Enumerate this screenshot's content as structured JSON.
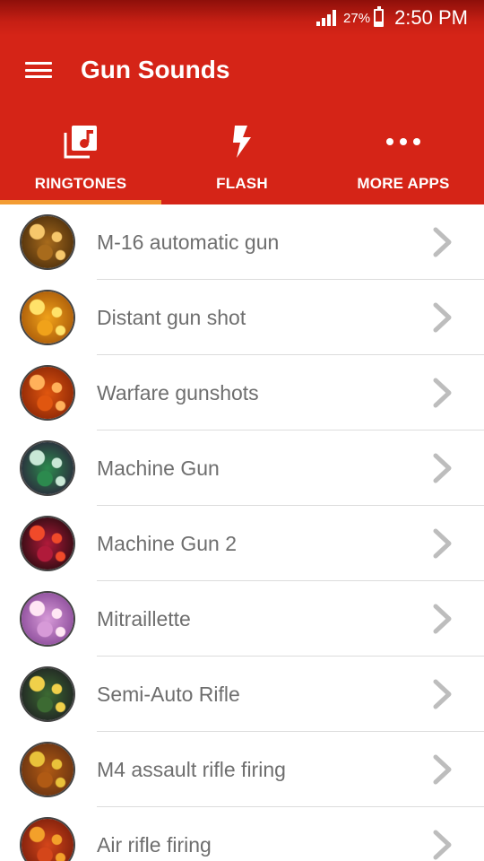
{
  "status_bar": {
    "battery_percent": "27%",
    "battery_level": 0.27,
    "time": "2:50 PM"
  },
  "app_bar": {
    "title": "Gun Sounds",
    "menu_icon": "hamburger-menu-icon"
  },
  "tabs": [
    {
      "label": "RINGTONES",
      "icon": "music-library-icon",
      "selected": true
    },
    {
      "label": "FLASH",
      "icon": "lightning-bolt-icon",
      "selected": false
    },
    {
      "label": "MORE APPS",
      "icon": "more-horizontal-icon",
      "selected": false
    }
  ],
  "colors": {
    "primary": "#d52417",
    "status_bar": "#b01a10",
    "tab_indicator": "#f39c33",
    "item_text": "#6e6e6e",
    "chevron": "#bdbdbd",
    "divider": "#dcdcdc"
  },
  "ringtones": [
    {
      "title": "M-16 automatic gun",
      "thumb": [
        "#f6c76b",
        "#a86b1c",
        "#3a2208"
      ]
    },
    {
      "title": "Distant gun shot",
      "thumb": [
        "#ffe26a",
        "#f0a21a",
        "#9a4a05"
      ]
    },
    {
      "title": "Warfare gunshots",
      "thumb": [
        "#ffb15a",
        "#e0560f",
        "#7a1c04"
      ]
    },
    {
      "title": "Machine Gun",
      "thumb": [
        "#c9e8d6",
        "#2c8a4e",
        "#2a1338"
      ]
    },
    {
      "title": "Machine Gun 2",
      "thumb": [
        "#f04a2a",
        "#b01a3a",
        "#120808"
      ]
    },
    {
      "title": "Mitraillette",
      "thumb": [
        "#ffe6f4",
        "#d79ad8",
        "#7a3a8c"
      ]
    },
    {
      "title": "Semi-Auto Rifle",
      "thumb": [
        "#f0d04a",
        "#3c6a32",
        "#1a1420"
      ]
    },
    {
      "title": "M4 assault rifle firing",
      "thumb": [
        "#e9c23a",
        "#b05a14",
        "#5a2a10"
      ]
    },
    {
      "title": "Air rifle firing",
      "thumb": [
        "#f3a02a",
        "#d4461a",
        "#6a1608"
      ]
    }
  ]
}
